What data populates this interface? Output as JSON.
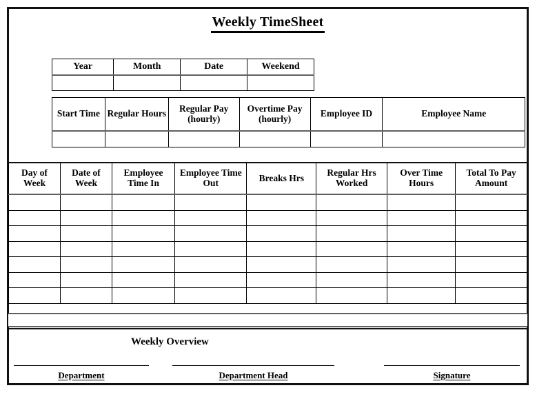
{
  "document": {
    "title": "Weekly TimeSheet"
  },
  "period_table": {
    "headers": [
      "Year",
      "Month",
      "Date",
      "Weekend"
    ],
    "values": [
      "",
      "",
      "",
      ""
    ]
  },
  "employee_table": {
    "headers": [
      "Start Time",
      "Regular Hours",
      "Regular Pay (hourly)",
      "Overtime Pay (hourly)",
      "Employee ID",
      "Employee Name"
    ],
    "values": [
      "",
      "",
      "",
      "",
      "",
      ""
    ]
  },
  "hours_table": {
    "headers": [
      "Day of Week",
      "Date of Week",
      "Employee Time In",
      "Employee Time Out",
      "Breaks Hrs",
      "Regular Hrs Worked",
      "Over Time Hours",
      "Total To Pay Amount"
    ],
    "rows": [
      [
        "",
        "",
        "",
        "",
        "",
        "",
        "",
        ""
      ],
      [
        "",
        "",
        "",
        "",
        "",
        "",
        "",
        ""
      ],
      [
        "",
        "",
        "",
        "",
        "",
        "",
        "",
        ""
      ],
      [
        "",
        "",
        "",
        "",
        "",
        "",
        "",
        ""
      ],
      [
        "",
        "",
        "",
        "",
        "",
        "",
        "",
        ""
      ],
      [
        "",
        "",
        "",
        "",
        "",
        "",
        "",
        ""
      ],
      [
        "",
        "",
        "",
        "",
        "",
        "",
        "",
        ""
      ]
    ]
  },
  "footer": {
    "overview_label": "Weekly Overview",
    "signatures": [
      {
        "label": "Department",
        "value": ""
      },
      {
        "label": "Department Head",
        "value": ""
      },
      {
        "label": "Signature",
        "value": ""
      }
    ]
  }
}
